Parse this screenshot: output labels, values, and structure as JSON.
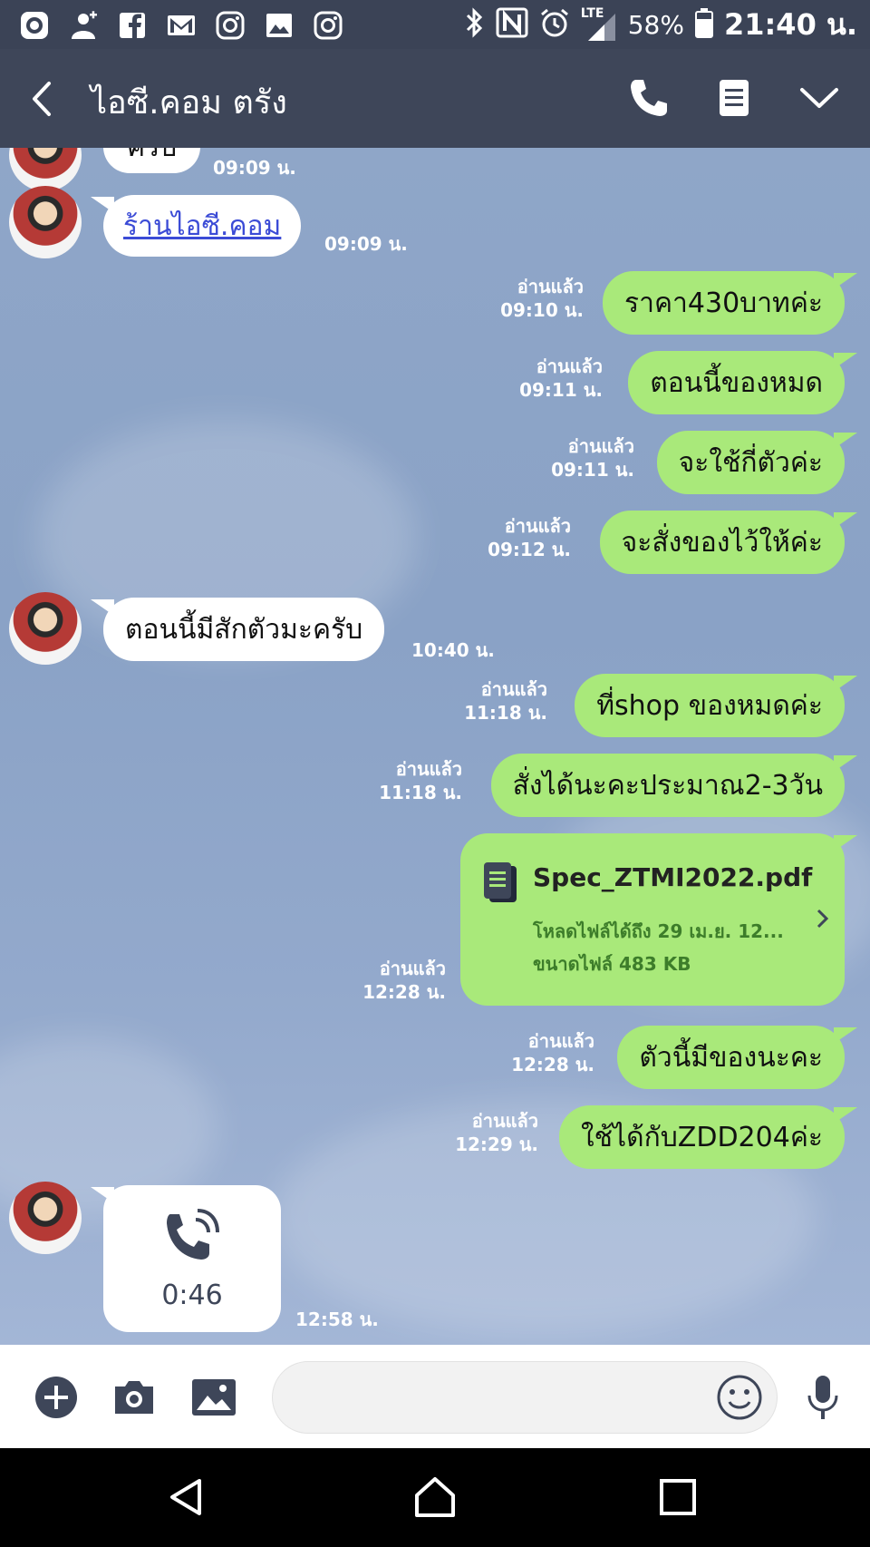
{
  "status_bar": {
    "battery": "58%",
    "time": "21:40 น.",
    "network": "LTE",
    "left_icons": [
      "record-icon",
      "add-person-icon",
      "facebook-icon",
      "gmail-icon",
      "instagram-icon",
      "gallery-icon",
      "instagram-icon"
    ],
    "right_icons": [
      "bluetooth-icon",
      "nfc-icon",
      "alarm-icon",
      "signal-icon",
      "battery-icon"
    ]
  },
  "header": {
    "title": "ไอซี.คอม ตรัง",
    "icons": [
      "back-icon",
      "phone-icon",
      "notes-icon",
      "chevron-down-icon"
    ]
  },
  "messages": [
    {
      "side": "in",
      "partial": true,
      "text": "ครับ",
      "time": "09:09 น."
    },
    {
      "side": "in",
      "text": "ร้านไอซี.คอม",
      "link": true,
      "time": "09:09 น."
    },
    {
      "side": "out",
      "read": "อ่านแล้ว",
      "text": "ราคา430บาทค่ะ",
      "time": "09:10 น."
    },
    {
      "side": "out",
      "read": "อ่านแล้ว",
      "text": "ตอนนี้ของหมด",
      "time": "09:11 น."
    },
    {
      "side": "out",
      "read": "อ่านแล้ว",
      "text": "จะใช้กี่ตัวค่ะ",
      "time": "09:11 น."
    },
    {
      "side": "out",
      "read": "อ่านแล้ว",
      "text": "จะสั่งของไว้ให้ค่ะ",
      "time": "09:12 น."
    },
    {
      "side": "in",
      "text": "ตอนนี้มีสักตัวมะครับ",
      "time": "10:40 น."
    },
    {
      "side": "out",
      "read": "อ่านแล้ว",
      "text": "ที่shop ของหมดค่ะ",
      "time": "11:18 น."
    },
    {
      "side": "out",
      "read": "อ่านแล้ว",
      "text": "สั่งได้นะคะประมาณ2-3วัน",
      "time": "11:18 น."
    },
    {
      "side": "out",
      "read": "อ่านแล้ว",
      "time": "12:28 น.",
      "file": {
        "name": "Spec_ZTMI2022.pdf",
        "expiry": "โหลดไฟล์ได้ถึง 29 เม.ย. 12...",
        "size": "ขนาดไฟล์ 483 KB"
      }
    },
    {
      "side": "out",
      "read": "อ่านแล้ว",
      "text": "ตัวนี้มีของนะคะ",
      "time": "12:28 น."
    },
    {
      "side": "out",
      "read": "อ่านแล้ว",
      "text": "ใช้ได้กับZDD204ค่ะ",
      "time": "12:29 น."
    },
    {
      "side": "in",
      "call": "0:46",
      "time": "12:58 น."
    }
  ],
  "input_bar": {
    "placeholder": "",
    "icons": [
      "plus-icon",
      "camera-icon",
      "image-icon",
      "emoji-icon",
      "microphone-icon"
    ]
  },
  "nav_bar": {
    "icons": [
      "back-triangle-icon",
      "home-icon",
      "recents-icon"
    ]
  },
  "colors": {
    "header": "#3e4659",
    "outgoing_bubble": "#a9e97a",
    "incoming_bubble": "#ffffff",
    "chat_background": "#8fa6c8"
  }
}
